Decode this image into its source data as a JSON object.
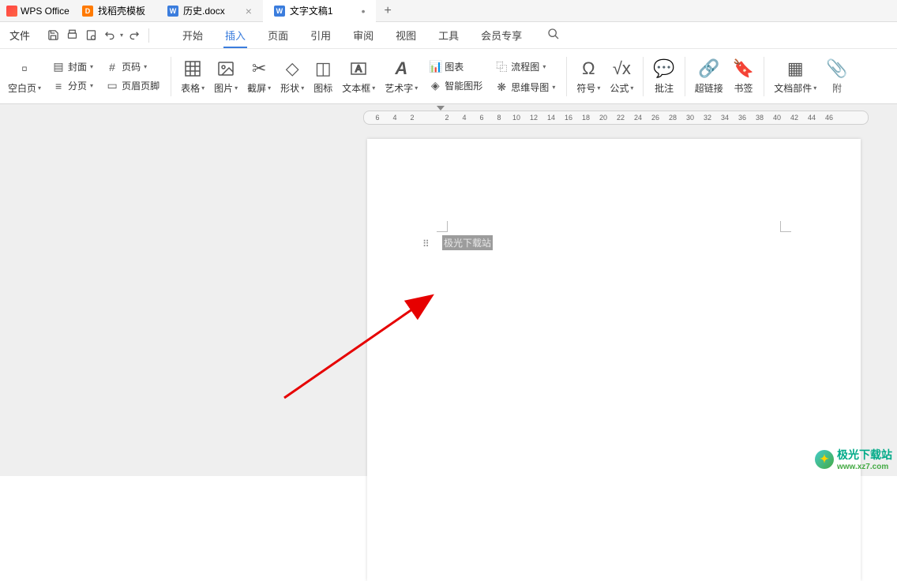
{
  "app": {
    "name": "WPS Office"
  },
  "tabs": [
    {
      "label": "找稻壳模板",
      "icon_type": "d"
    },
    {
      "label": "历史.docx",
      "icon_type": "w"
    },
    {
      "label": "文字文稿1",
      "icon_type": "w",
      "active": true
    }
  ],
  "add_tab": "+",
  "menu": {
    "file": "文件",
    "ribbon_tabs": [
      "开始",
      "插入",
      "页面",
      "引用",
      "审阅",
      "视图",
      "工具",
      "会员专享"
    ],
    "active_ribbon_index": 1
  },
  "ribbon": {
    "blank_page": "空白页",
    "cover": "封面",
    "page_number": "页码",
    "page_break": "分页",
    "header_footer": "页眉页脚",
    "table": "表格",
    "picture": "图片",
    "screenshot": "截屏",
    "shape": "形状",
    "icon": "图标",
    "textbox": "文本框",
    "wordart": "艺术字",
    "chart": "图表",
    "flowchart": "流程图",
    "smartart": "智能图形",
    "mindmap": "思维导图",
    "symbol": "符号",
    "formula": "公式",
    "comment": "批注",
    "hyperlink": "超链接",
    "bookmark": "书签",
    "doc_parts": "文档部件",
    "attachment": "附"
  },
  "ruler_numbers": [
    "6",
    "4",
    "2",
    "",
    "2",
    "4",
    "6",
    "8",
    "10",
    "12",
    "14",
    "16",
    "18",
    "20",
    "22",
    "24",
    "26",
    "28",
    "30",
    "32",
    "34",
    "36",
    "38",
    "40",
    "42",
    "44",
    "46"
  ],
  "document": {
    "selected_text": "极光下载站"
  },
  "watermark": {
    "text": "极光下载站",
    "url": "www.xz7.com"
  }
}
